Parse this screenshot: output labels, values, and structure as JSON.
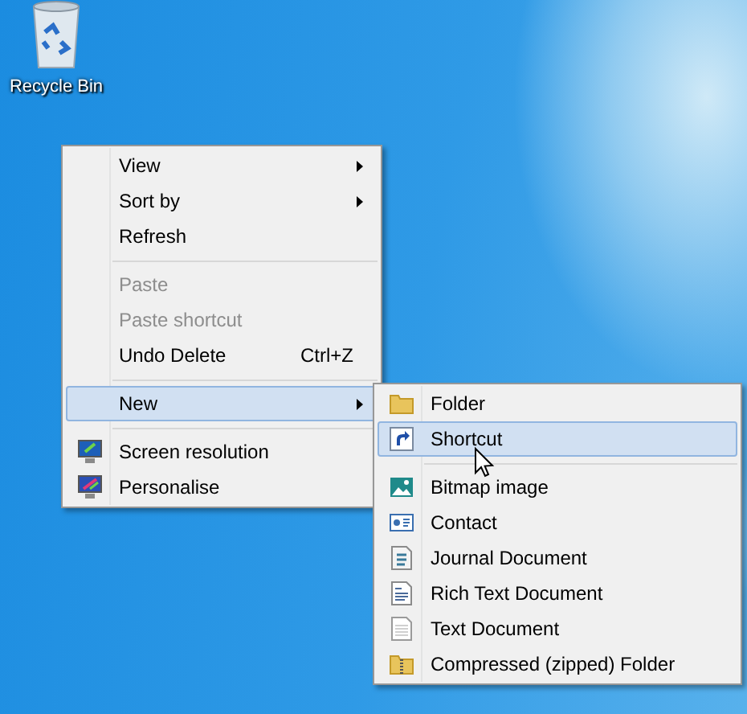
{
  "desktop_icons": [
    {
      "label": "Recycle Bin"
    }
  ],
  "context_menu": {
    "items": [
      {
        "kind": "submenu",
        "label": "View",
        "disabled": false,
        "selected": false
      },
      {
        "kind": "submenu",
        "label": "Sort by",
        "disabled": false,
        "selected": false
      },
      {
        "kind": "command",
        "label": "Refresh",
        "disabled": false,
        "selected": false
      },
      {
        "kind": "separator"
      },
      {
        "kind": "command",
        "label": "Paste",
        "disabled": true,
        "selected": false
      },
      {
        "kind": "command",
        "label": "Paste shortcut",
        "disabled": true,
        "selected": false
      },
      {
        "kind": "command",
        "label": "Undo Delete",
        "shortcut": "Ctrl+Z",
        "disabled": false,
        "selected": false
      },
      {
        "kind": "separator"
      },
      {
        "kind": "submenu",
        "label": "New",
        "disabled": false,
        "selected": true
      },
      {
        "kind": "separator"
      },
      {
        "kind": "resolution",
        "label": "Screen resolution",
        "disabled": false,
        "selected": false
      },
      {
        "kind": "personalise",
        "label": "Personalise",
        "disabled": false,
        "selected": false
      }
    ]
  },
  "new_submenu": {
    "items": [
      {
        "kind": "folder",
        "label": "Folder",
        "selected": false
      },
      {
        "kind": "shortcut",
        "label": "Shortcut",
        "selected": true
      },
      {
        "kind": "separator"
      },
      {
        "kind": "bitmap",
        "label": "Bitmap image",
        "selected": false
      },
      {
        "kind": "contact",
        "label": "Contact",
        "selected": false
      },
      {
        "kind": "journal",
        "label": "Journal Document",
        "selected": false
      },
      {
        "kind": "richtext",
        "label": "Rich Text Document",
        "selected": false
      },
      {
        "kind": "text",
        "label": "Text Document",
        "selected": false
      },
      {
        "kind": "zip",
        "label": "Compressed (zipped) Folder",
        "selected": false
      }
    ]
  }
}
